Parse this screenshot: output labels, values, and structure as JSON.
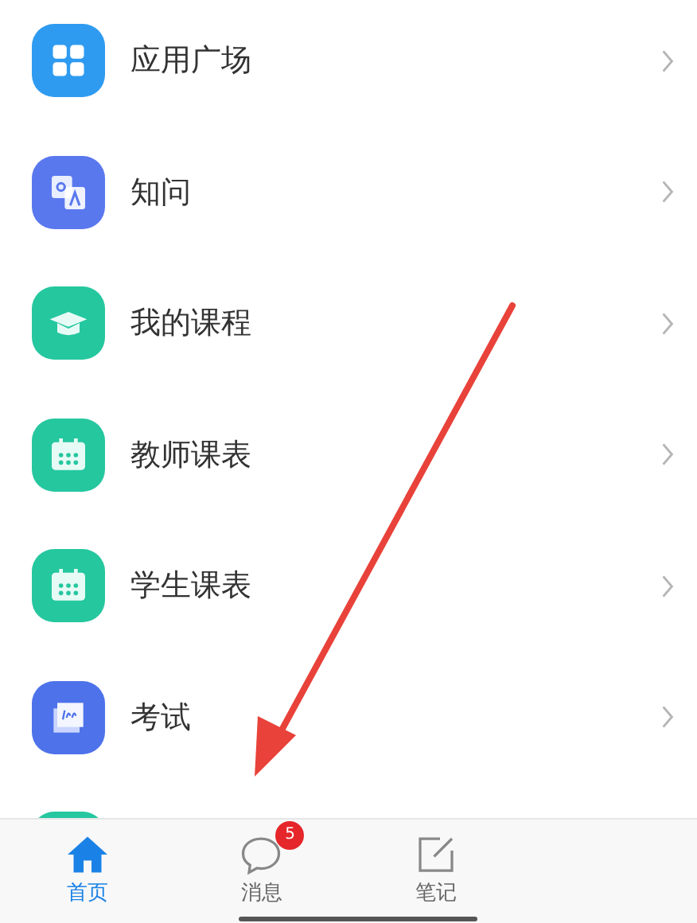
{
  "menu": [
    {
      "label": "应用广场",
      "kind": "grid",
      "color": "#2f9bf0"
    },
    {
      "label": "知问",
      "kind": "qa",
      "color": "#5a78ee"
    },
    {
      "label": "我的课程",
      "kind": "cap",
      "color": "#25c79f"
    },
    {
      "label": "教师课表",
      "kind": "calendar",
      "color": "#25c79f"
    },
    {
      "label": "学生课表",
      "kind": "calendar",
      "color": "#25c79f"
    },
    {
      "label": "考试",
      "kind": "exam",
      "color": "#4d72ea"
    },
    {
      "kind": "blank",
      "color": "#25c79f"
    }
  ],
  "tabs": [
    {
      "label": "首页",
      "kind": "home",
      "selected": true
    },
    {
      "label": "消息",
      "kind": "chat",
      "selected": false,
      "badge": "5"
    },
    {
      "label": "笔记",
      "kind": "note",
      "selected": false
    }
  ]
}
